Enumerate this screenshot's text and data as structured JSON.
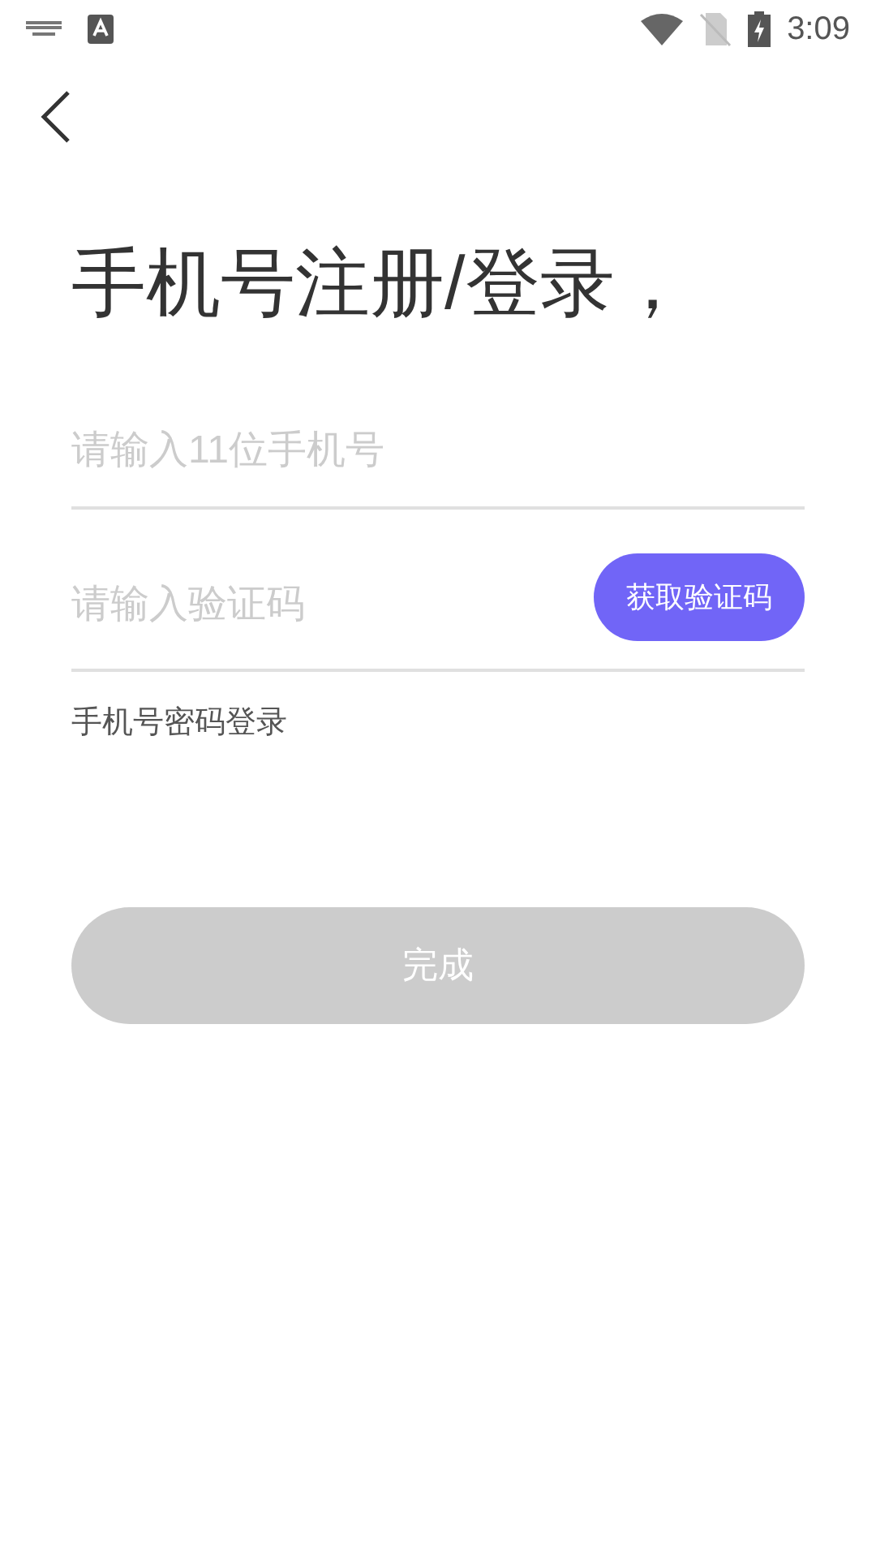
{
  "status_bar": {
    "time": "3:09"
  },
  "title": "手机号注册/登录，",
  "phone_field": {
    "placeholder": "请输入11位手机号"
  },
  "code_field": {
    "placeholder": "请输入验证码"
  },
  "get_code_button": {
    "label": "获取验证码"
  },
  "password_login_link": "手机号密码登录",
  "done_button": {
    "label": "完成",
    "disabled": true
  }
}
